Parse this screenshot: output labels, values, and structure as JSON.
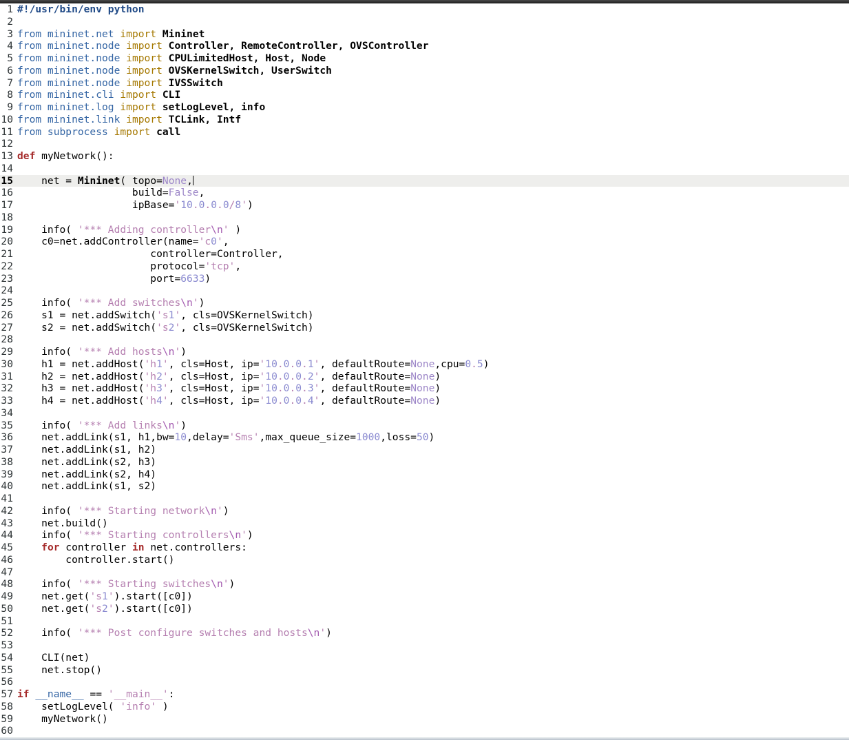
{
  "app": {
    "type": "code-editor",
    "language": "Python",
    "visible_line_count": 60
  },
  "chrome": {
    "top_bar_color": "#2b2b2b",
    "bottom_bar_color": "#bcc5cf"
  },
  "editor": {
    "background": "#ffffff",
    "current_line_number": 15,
    "current_line_background": "#eeeeec",
    "gutter_color": "#2e3436",
    "token_colors": {
      "p": "#000000",
      "sh": "#204a87",
      "blue": "#3465a4",
      "imp": "#a57800",
      "kw2": "#a52a2a",
      "b": "#000000",
      "str": "#b57fb0",
      "esc": "#a35bb0",
      "num": "#8a8ad0",
      "snum": "#8a8ad0",
      "const": "#9d87c8"
    },
    "bold_tokens": [
      "sh",
      "kw2",
      "b"
    ],
    "lines": [
      {
        "n": 1,
        "segs": [
          [
            "sh",
            "#!/usr/bin/env python"
          ]
        ]
      },
      {
        "n": 2,
        "segs": []
      },
      {
        "n": 3,
        "segs": [
          [
            "blue",
            "from mininet.net "
          ],
          [
            "imp",
            "import "
          ],
          [
            "b",
            "Mininet"
          ]
        ]
      },
      {
        "n": 4,
        "segs": [
          [
            "blue",
            "from mininet.node "
          ],
          [
            "imp",
            "import "
          ],
          [
            "b",
            "Controller, RemoteController, OVSController"
          ]
        ]
      },
      {
        "n": 5,
        "segs": [
          [
            "blue",
            "from mininet.node "
          ],
          [
            "imp",
            "import "
          ],
          [
            "b",
            "CPULimitedHost, Host, Node"
          ]
        ]
      },
      {
        "n": 6,
        "segs": [
          [
            "blue",
            "from mininet.node "
          ],
          [
            "imp",
            "import "
          ],
          [
            "b",
            "OVSKernelSwitch, UserSwitch"
          ]
        ]
      },
      {
        "n": 7,
        "segs": [
          [
            "blue",
            "from mininet.node "
          ],
          [
            "imp",
            "import "
          ],
          [
            "b",
            "IVSSwitch"
          ]
        ]
      },
      {
        "n": 8,
        "segs": [
          [
            "blue",
            "from mininet.cli "
          ],
          [
            "imp",
            "import "
          ],
          [
            "b",
            "CLI"
          ]
        ]
      },
      {
        "n": 9,
        "segs": [
          [
            "blue",
            "from mininet.log "
          ],
          [
            "imp",
            "import "
          ],
          [
            "b",
            "setLogLevel, info"
          ]
        ]
      },
      {
        "n": 10,
        "segs": [
          [
            "blue",
            "from mininet.link "
          ],
          [
            "imp",
            "import "
          ],
          [
            "b",
            "TCLink, Intf"
          ]
        ]
      },
      {
        "n": 11,
        "segs": [
          [
            "blue",
            "from subprocess "
          ],
          [
            "imp",
            "import "
          ],
          [
            "b",
            "call"
          ]
        ]
      },
      {
        "n": 12,
        "segs": []
      },
      {
        "n": 13,
        "segs": [
          [
            "kw2",
            "def "
          ],
          [
            "p",
            "myNetwork():"
          ]
        ]
      },
      {
        "n": 14,
        "segs": []
      },
      {
        "n": 15,
        "segs": [
          [
            "p",
            "    net = "
          ],
          [
            "b",
            "Mininet"
          ],
          [
            "p",
            "( topo="
          ],
          [
            "const",
            "None"
          ],
          [
            "p",
            ","
          ],
          [
            "caret",
            ""
          ]
        ]
      },
      {
        "n": 16,
        "segs": [
          [
            "p",
            "                   build="
          ],
          [
            "const",
            "False"
          ],
          [
            "p",
            ","
          ]
        ]
      },
      {
        "n": 17,
        "segs": [
          [
            "p",
            "                   ipBase="
          ],
          [
            "str",
            "'"
          ],
          [
            "snum",
            "10"
          ],
          [
            "str",
            "."
          ],
          [
            "snum",
            "0"
          ],
          [
            "str",
            "."
          ],
          [
            "snum",
            "0"
          ],
          [
            "str",
            "."
          ],
          [
            "snum",
            "0"
          ],
          [
            "str",
            "/"
          ],
          [
            "snum",
            "8"
          ],
          [
            "str",
            "'"
          ],
          [
            "p",
            ")"
          ]
        ]
      },
      {
        "n": 18,
        "segs": []
      },
      {
        "n": 19,
        "segs": [
          [
            "p",
            "    info( "
          ],
          [
            "str",
            "'*** Adding controller"
          ],
          [
            "esc",
            "\\n"
          ],
          [
            "str",
            "'"
          ],
          [
            "p",
            " )"
          ]
        ]
      },
      {
        "n": 20,
        "segs": [
          [
            "p",
            "    c0=net.addController(name="
          ],
          [
            "str",
            "'c"
          ],
          [
            "snum",
            "0"
          ],
          [
            "str",
            "'"
          ],
          [
            "p",
            ","
          ]
        ]
      },
      {
        "n": 21,
        "segs": [
          [
            "p",
            "                      controller=Controller,"
          ]
        ]
      },
      {
        "n": 22,
        "segs": [
          [
            "p",
            "                      protocol="
          ],
          [
            "str",
            "'tcp'"
          ],
          [
            "p",
            ","
          ]
        ]
      },
      {
        "n": 23,
        "segs": [
          [
            "p",
            "                      port="
          ],
          [
            "num",
            "6633"
          ],
          [
            "p",
            ")"
          ]
        ]
      },
      {
        "n": 24,
        "segs": []
      },
      {
        "n": 25,
        "segs": [
          [
            "p",
            "    info( "
          ],
          [
            "str",
            "'*** Add switches"
          ],
          [
            "esc",
            "\\n"
          ],
          [
            "str",
            "'"
          ],
          [
            "p",
            ")"
          ]
        ]
      },
      {
        "n": 26,
        "segs": [
          [
            "p",
            "    s1 = net.addSwitch("
          ],
          [
            "str",
            "'s"
          ],
          [
            "snum",
            "1"
          ],
          [
            "str",
            "'"
          ],
          [
            "p",
            ", cls=OVSKernelSwitch)"
          ]
        ]
      },
      {
        "n": 27,
        "segs": [
          [
            "p",
            "    s2 = net.addSwitch("
          ],
          [
            "str",
            "'s"
          ],
          [
            "snum",
            "2"
          ],
          [
            "str",
            "'"
          ],
          [
            "p",
            ", cls=OVSKernelSwitch)"
          ]
        ]
      },
      {
        "n": 28,
        "segs": []
      },
      {
        "n": 29,
        "segs": [
          [
            "p",
            "    info( "
          ],
          [
            "str",
            "'*** Add hosts"
          ],
          [
            "esc",
            "\\n"
          ],
          [
            "str",
            "'"
          ],
          [
            "p",
            ")"
          ]
        ]
      },
      {
        "n": 30,
        "segs": [
          [
            "p",
            "    h1 = net.addHost("
          ],
          [
            "str",
            "'h"
          ],
          [
            "snum",
            "1"
          ],
          [
            "str",
            "'"
          ],
          [
            "p",
            ", cls=Host, ip="
          ],
          [
            "str",
            "'"
          ],
          [
            "snum",
            "10"
          ],
          [
            "str",
            "."
          ],
          [
            "snum",
            "0"
          ],
          [
            "str",
            "."
          ],
          [
            "snum",
            "0"
          ],
          [
            "str",
            "."
          ],
          [
            "snum",
            "1"
          ],
          [
            "str",
            "'"
          ],
          [
            "p",
            ", defaultRoute="
          ],
          [
            "const",
            "None"
          ],
          [
            "p",
            ",cpu="
          ],
          [
            "num",
            "0"
          ],
          [
            "str",
            "."
          ],
          [
            "num",
            "5"
          ],
          [
            "p",
            ")"
          ]
        ]
      },
      {
        "n": 31,
        "segs": [
          [
            "p",
            "    h2 = net.addHost("
          ],
          [
            "str",
            "'h"
          ],
          [
            "snum",
            "2"
          ],
          [
            "str",
            "'"
          ],
          [
            "p",
            ", cls=Host, ip="
          ],
          [
            "str",
            "'"
          ],
          [
            "snum",
            "10"
          ],
          [
            "str",
            "."
          ],
          [
            "snum",
            "0"
          ],
          [
            "str",
            "."
          ],
          [
            "snum",
            "0"
          ],
          [
            "str",
            "."
          ],
          [
            "snum",
            "2"
          ],
          [
            "str",
            "'"
          ],
          [
            "p",
            ", defaultRoute="
          ],
          [
            "const",
            "None"
          ],
          [
            "p",
            ")"
          ]
        ]
      },
      {
        "n": 32,
        "segs": [
          [
            "p",
            "    h3 = net.addHost("
          ],
          [
            "str",
            "'h"
          ],
          [
            "snum",
            "3"
          ],
          [
            "str",
            "'"
          ],
          [
            "p",
            ", cls=Host, ip="
          ],
          [
            "str",
            "'"
          ],
          [
            "snum",
            "10"
          ],
          [
            "str",
            "."
          ],
          [
            "snum",
            "0"
          ],
          [
            "str",
            "."
          ],
          [
            "snum",
            "0"
          ],
          [
            "str",
            "."
          ],
          [
            "snum",
            "3"
          ],
          [
            "str",
            "'"
          ],
          [
            "p",
            ", defaultRoute="
          ],
          [
            "const",
            "None"
          ],
          [
            "p",
            ")"
          ]
        ]
      },
      {
        "n": 33,
        "segs": [
          [
            "p",
            "    h4 = net.addHost("
          ],
          [
            "str",
            "'h"
          ],
          [
            "snum",
            "4"
          ],
          [
            "str",
            "'"
          ],
          [
            "p",
            ", cls=Host, ip="
          ],
          [
            "str",
            "'"
          ],
          [
            "snum",
            "10"
          ],
          [
            "str",
            "."
          ],
          [
            "snum",
            "0"
          ],
          [
            "str",
            "."
          ],
          [
            "snum",
            "0"
          ],
          [
            "str",
            "."
          ],
          [
            "snum",
            "4"
          ],
          [
            "str",
            "'"
          ],
          [
            "p",
            ", defaultRoute="
          ],
          [
            "const",
            "None"
          ],
          [
            "p",
            ")"
          ]
        ]
      },
      {
        "n": 34,
        "segs": []
      },
      {
        "n": 35,
        "segs": [
          [
            "p",
            "    info( "
          ],
          [
            "str",
            "'*** Add links"
          ],
          [
            "esc",
            "\\n"
          ],
          [
            "str",
            "'"
          ],
          [
            "p",
            ")"
          ]
        ]
      },
      {
        "n": 36,
        "segs": [
          [
            "p",
            "    net.addLink(s1, h1,bw="
          ],
          [
            "num",
            "10"
          ],
          [
            "p",
            ",delay="
          ],
          [
            "str",
            "'Sms'"
          ],
          [
            "p",
            ",max_queue_size="
          ],
          [
            "num",
            "1000"
          ],
          [
            "p",
            ",loss="
          ],
          [
            "num",
            "50"
          ],
          [
            "p",
            ")"
          ]
        ]
      },
      {
        "n": 37,
        "segs": [
          [
            "p",
            "    net.addLink(s1, h2)"
          ]
        ]
      },
      {
        "n": 38,
        "segs": [
          [
            "p",
            "    net.addLink(s2, h3)"
          ]
        ]
      },
      {
        "n": 39,
        "segs": [
          [
            "p",
            "    net.addLink(s2, h4)"
          ]
        ]
      },
      {
        "n": 40,
        "segs": [
          [
            "p",
            "    net.addLink(s1, s2)"
          ]
        ]
      },
      {
        "n": 41,
        "segs": []
      },
      {
        "n": 42,
        "segs": [
          [
            "p",
            "    info( "
          ],
          [
            "str",
            "'*** Starting network"
          ],
          [
            "esc",
            "\\n"
          ],
          [
            "str",
            "'"
          ],
          [
            "p",
            ")"
          ]
        ]
      },
      {
        "n": 43,
        "segs": [
          [
            "p",
            "    net.build()"
          ]
        ]
      },
      {
        "n": 44,
        "segs": [
          [
            "p",
            "    info( "
          ],
          [
            "str",
            "'*** Starting controllers"
          ],
          [
            "esc",
            "\\n"
          ],
          [
            "str",
            "'"
          ],
          [
            "p",
            ")"
          ]
        ]
      },
      {
        "n": 45,
        "segs": [
          [
            "p",
            "    "
          ],
          [
            "kw2",
            "for"
          ],
          [
            "p",
            " controller "
          ],
          [
            "kw2",
            "in"
          ],
          [
            "p",
            " net.controllers:"
          ]
        ]
      },
      {
        "n": 46,
        "segs": [
          [
            "p",
            "        controller.start()"
          ]
        ]
      },
      {
        "n": 47,
        "segs": []
      },
      {
        "n": 48,
        "segs": [
          [
            "p",
            "    info( "
          ],
          [
            "str",
            "'*** Starting switches"
          ],
          [
            "esc",
            "\\n"
          ],
          [
            "str",
            "'"
          ],
          [
            "p",
            ")"
          ]
        ]
      },
      {
        "n": 49,
        "segs": [
          [
            "p",
            "    net.get("
          ],
          [
            "str",
            "'s"
          ],
          [
            "snum",
            "1"
          ],
          [
            "str",
            "'"
          ],
          [
            "p",
            ").start([c0])"
          ]
        ]
      },
      {
        "n": 50,
        "segs": [
          [
            "p",
            "    net.get("
          ],
          [
            "str",
            "'s"
          ],
          [
            "snum",
            "2"
          ],
          [
            "str",
            "'"
          ],
          [
            "p",
            ").start([c0])"
          ]
        ]
      },
      {
        "n": 51,
        "segs": []
      },
      {
        "n": 52,
        "segs": [
          [
            "p",
            "    info( "
          ],
          [
            "str",
            "'*** Post configure switches and hosts"
          ],
          [
            "esc",
            "\\n"
          ],
          [
            "str",
            "'"
          ],
          [
            "p",
            ")"
          ]
        ]
      },
      {
        "n": 53,
        "segs": []
      },
      {
        "n": 54,
        "segs": [
          [
            "p",
            "    CLI(net)"
          ]
        ]
      },
      {
        "n": 55,
        "segs": [
          [
            "p",
            "    net.stop()"
          ]
        ]
      },
      {
        "n": 56,
        "segs": []
      },
      {
        "n": 57,
        "segs": [
          [
            "kw2",
            "if "
          ],
          [
            "blue",
            "__name__"
          ],
          [
            "p",
            " == "
          ],
          [
            "str",
            "'__main__'"
          ],
          [
            "p",
            ":"
          ]
        ]
      },
      {
        "n": 58,
        "segs": [
          [
            "p",
            "    setLogLevel( "
          ],
          [
            "str",
            "'info'"
          ],
          [
            "p",
            " )"
          ]
        ]
      },
      {
        "n": 59,
        "segs": [
          [
            "p",
            "    myNetwork()"
          ]
        ]
      },
      {
        "n": 60,
        "segs": []
      }
    ]
  }
}
